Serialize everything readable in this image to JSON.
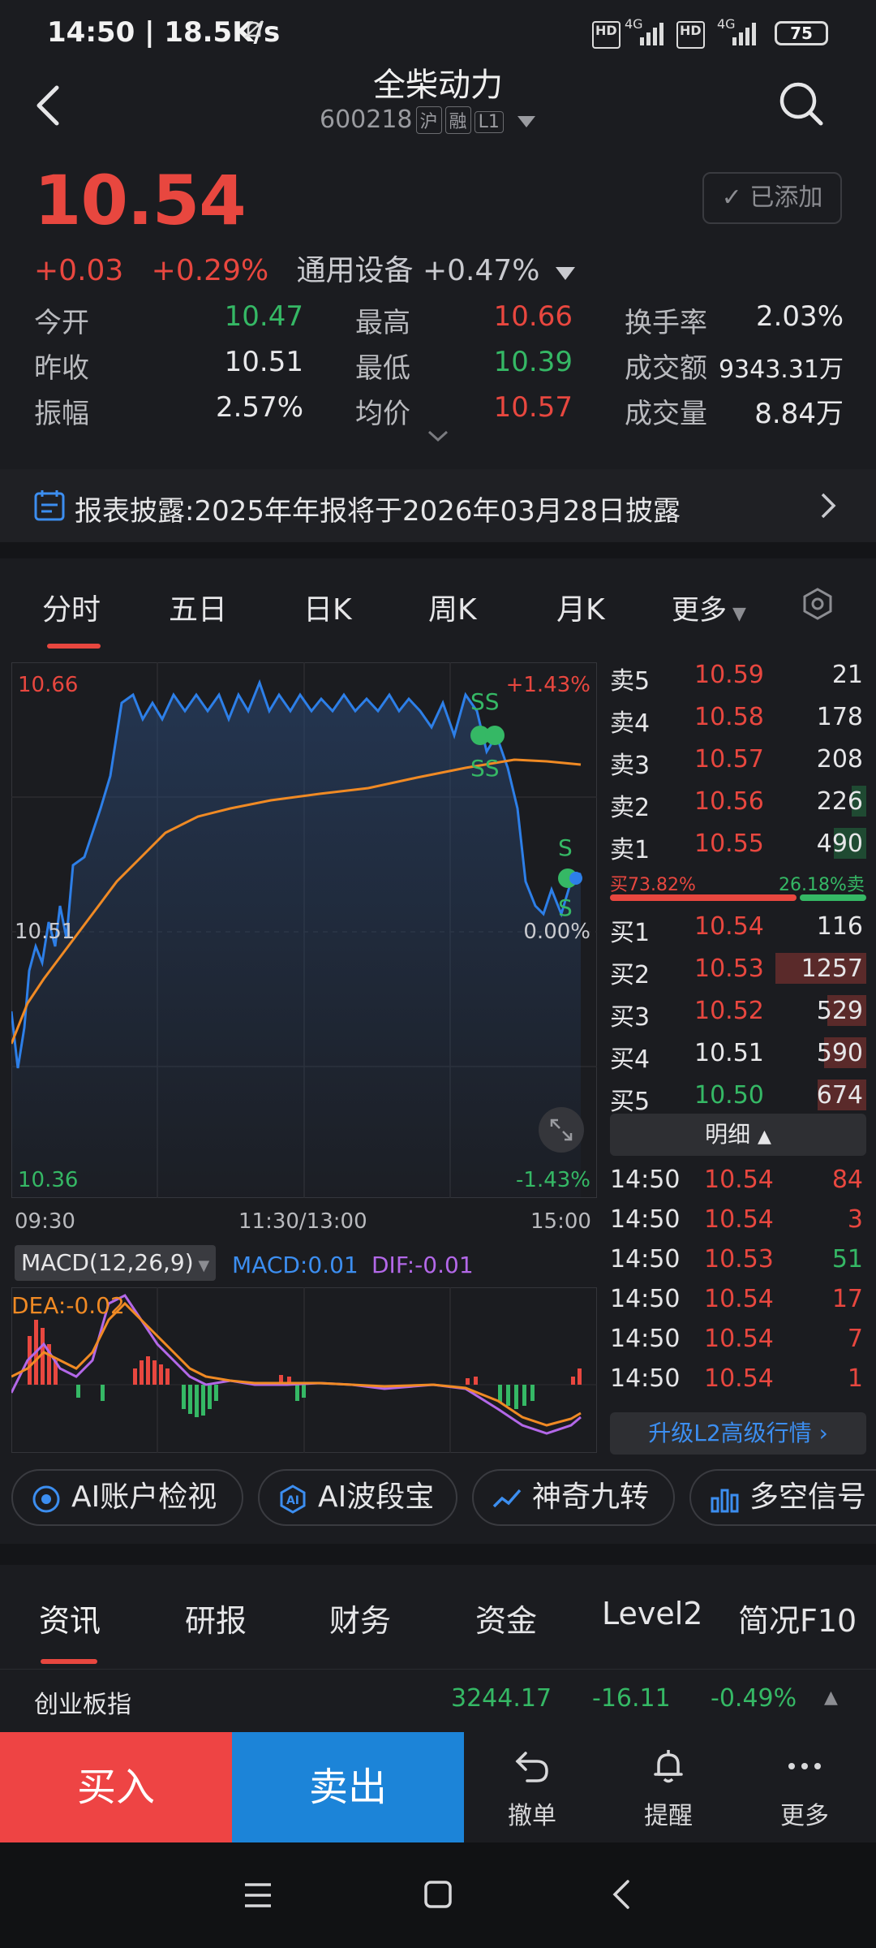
{
  "status_bar": {
    "time": "14:50 | 18.5K/s",
    "net1": "4G",
    "net2": "4G",
    "hd": "HD",
    "battery": "75"
  },
  "header": {
    "title": "全柴动力",
    "code": "600218",
    "tags": [
      "沪",
      "融",
      "L1"
    ]
  },
  "quote": {
    "price": "10.54",
    "change": "+0.03",
    "change_pct": "+0.29%",
    "sector": "通用设备 +0.47%",
    "added_label": "已添加",
    "stats": [
      {
        "label": "今开",
        "value": "10.47",
        "color": "green"
      },
      {
        "label": "最高",
        "value": "10.66",
        "color": "red"
      },
      {
        "label": "换手率",
        "value": "2.03%",
        "color": "white"
      },
      {
        "label": "昨收",
        "value": "10.51",
        "color": "white"
      },
      {
        "label": "最低",
        "value": "10.39",
        "color": "green"
      },
      {
        "label": "成交额",
        "value": "9343.31万",
        "color": "white"
      },
      {
        "label": "振幅",
        "value": "2.57%",
        "color": "white"
      },
      {
        "label": "均价",
        "value": "10.57",
        "color": "red"
      },
      {
        "label": "成交量",
        "value": "8.84万",
        "color": "white"
      }
    ]
  },
  "notice": {
    "text": "报表披露:2025年年报将于2026年03月28日披露"
  },
  "chart_tabs": [
    "分时",
    "五日",
    "日K",
    "周K",
    "月K",
    "更多"
  ],
  "chart": {
    "price_high": "10.66",
    "price_mid": "10.51",
    "price_low": "10.36",
    "pct_high": "+1.43%",
    "pct_mid": "0.00%",
    "pct_low": "-1.43%",
    "time_start": "09:30",
    "time_mid": "11:30/13:00",
    "time_end": "15:00",
    "macd_label": "MACD(12,26,9)",
    "macd_value": "MACD:0.01",
    "dif_value": "DIF:-0.01",
    "dea_value": "DEA:-0.02",
    "marker_ss": "SS",
    "marker_s": "S"
  },
  "chart_data": {
    "type": "line",
    "y_range": [
      10.36,
      10.66
    ],
    "series": []
  },
  "order_book": {
    "asks": [
      {
        "label": "卖5",
        "price": "10.59",
        "volume": "21"
      },
      {
        "label": "卖4",
        "price": "10.58",
        "volume": "178"
      },
      {
        "label": "卖3",
        "price": "10.57",
        "volume": "208"
      },
      {
        "label": "卖2",
        "price": "10.56",
        "volume": "226"
      },
      {
        "label": "卖1",
        "price": "10.55",
        "volume": "490"
      }
    ],
    "buy_ratio": "买73.82%",
    "sell_ratio": "26.18%卖",
    "bids": [
      {
        "label": "买1",
        "price": "10.54",
        "volume": "116"
      },
      {
        "label": "买2",
        "price": "10.53",
        "volume": "1257"
      },
      {
        "label": "买3",
        "price": "10.52",
        "volume": "529"
      },
      {
        "label": "买4",
        "price": "10.51",
        "volume": "590"
      },
      {
        "label": "买5",
        "price": "10.50",
        "volume": "674"
      }
    ],
    "detail_label": "明细",
    "ticks": [
      {
        "time": "14:50",
        "price": "10.54",
        "volume": "84"
      },
      {
        "time": "14:50",
        "price": "10.54",
        "volume": "3"
      },
      {
        "time": "14:50",
        "price": "10.53",
        "volume": "51"
      },
      {
        "time": "14:50",
        "price": "10.54",
        "volume": "17"
      },
      {
        "time": "14:50",
        "price": "10.54",
        "volume": "7"
      },
      {
        "time": "14:50",
        "price": "10.54",
        "volume": "1"
      }
    ],
    "upgrade_label": "升级L2高级行情"
  },
  "ai_chips": [
    "AI账户检视",
    "AI波段宝",
    "神奇九转",
    "多空信号"
  ],
  "news_tabs": [
    "资讯",
    "研报",
    "财务",
    "资金",
    "Level2",
    "简况F10"
  ],
  "index_row": {
    "name": "创业板指",
    "value": "3244.17",
    "change": "-16.11",
    "pct": "-0.49%"
  },
  "bottom": {
    "buy": "买入",
    "sell": "卖出",
    "cancel": "撤单",
    "alert": "提醒",
    "more": "更多"
  },
  "colors": {
    "up": "#e8473f",
    "down": "#35b865",
    "accent": "#3c8ef0",
    "bg": "#1b1c20"
  }
}
